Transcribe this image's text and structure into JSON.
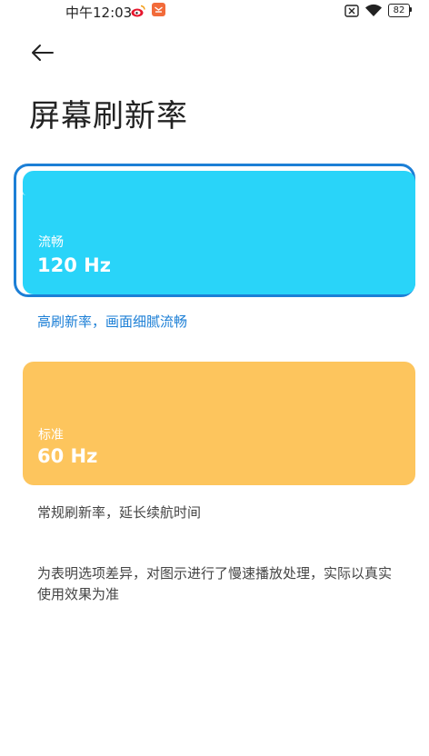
{
  "status_bar": {
    "time": "中午12:03",
    "battery": "82",
    "icons": [
      "weibo-icon",
      "app-notification-icon",
      "sim-off-icon",
      "wifi-icon",
      "battery-icon"
    ]
  },
  "header": {
    "back_icon": "arrow-left-icon",
    "title": "屏幕刷新率"
  },
  "options": [
    {
      "id": "smooth",
      "name": "流畅",
      "rate": "120 Hz",
      "description": "高刷新率，画面细腻流畅",
      "selected": true,
      "color": "#29d4f9"
    },
    {
      "id": "standard",
      "name": "标准",
      "rate": "60 Hz",
      "description": "常规刷新率，延长续航时间",
      "selected": false,
      "color": "#fdc55d"
    }
  ],
  "footnote": "为表明选项差异，对图示进行了慢速播放处理，实际以真实使用效果为准",
  "colors": {
    "accent": "#1c7fd6",
    "selected_ring": "#1c7fd6"
  }
}
